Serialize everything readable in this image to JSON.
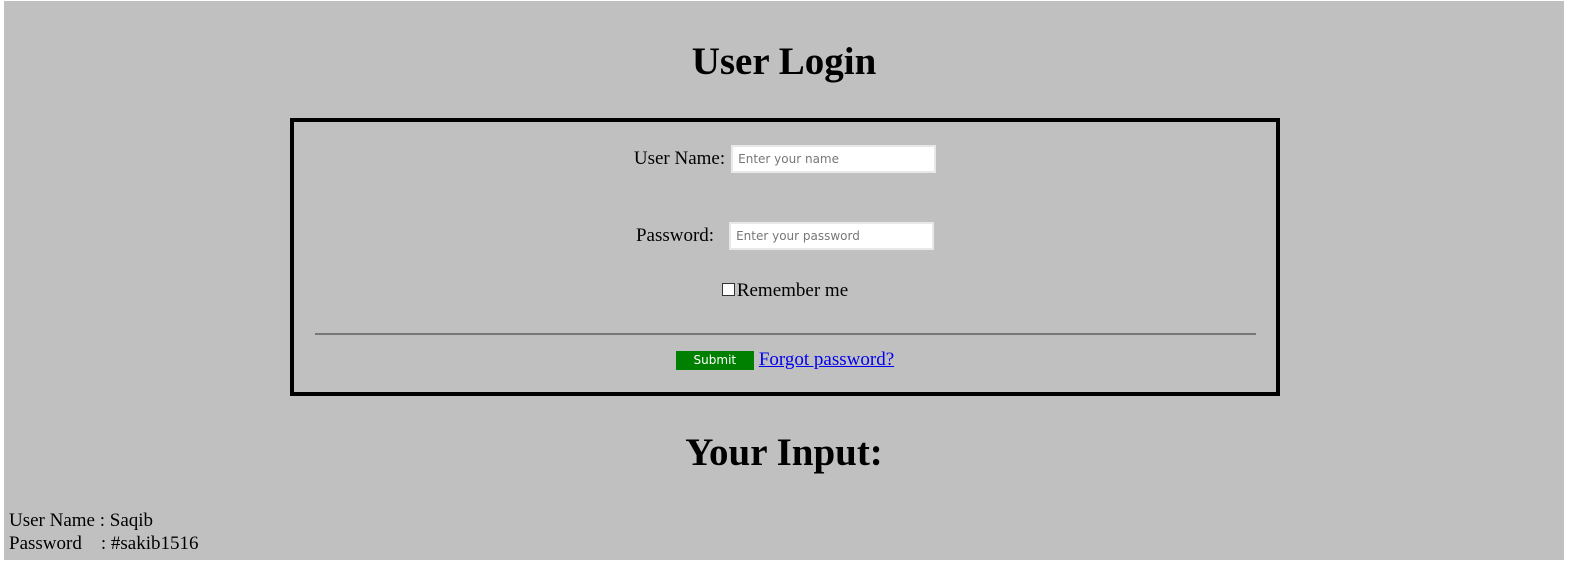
{
  "page": {
    "title": "User Login",
    "background_color": "#c0c0c0"
  },
  "login_form": {
    "username": {
      "label": "User Name:",
      "placeholder": "Enter your name",
      "value": ""
    },
    "password": {
      "label": "Password:",
      "placeholder": "Enter your password",
      "value": ""
    },
    "remember": {
      "label": "Remember me",
      "checked": false
    },
    "submit": {
      "label": "Submit",
      "color": "#008000"
    },
    "forgot_link": {
      "label": "Forgot password?",
      "color": "#0000ee"
    }
  },
  "output": {
    "heading": "Your Input:",
    "username_line": "User Name : Saqib",
    "password_line": "Password    : #sakib1516"
  }
}
